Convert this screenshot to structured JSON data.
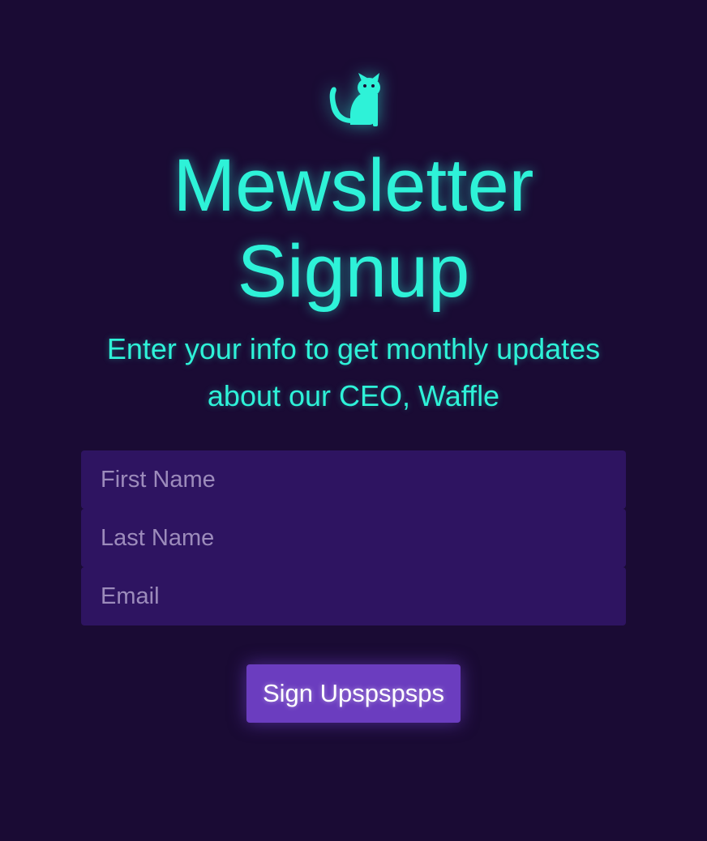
{
  "logo": {
    "icon": "cat-icon",
    "color": "#2ef2d8"
  },
  "title": "Mewsletter Signup",
  "subtitle": "Enter your info to get monthly updates about our CEO, Waffle",
  "form": {
    "first_name": {
      "placeholder": "First Name",
      "value": ""
    },
    "last_name": {
      "placeholder": "Last Name",
      "value": ""
    },
    "email": {
      "placeholder": "Email",
      "value": ""
    },
    "submit_label": "Sign Upspspsps"
  },
  "colors": {
    "background": "#1a0b34",
    "accent": "#2ef2d8",
    "field_bg": "#2e1461",
    "button_bg": "#6b3dbf"
  }
}
